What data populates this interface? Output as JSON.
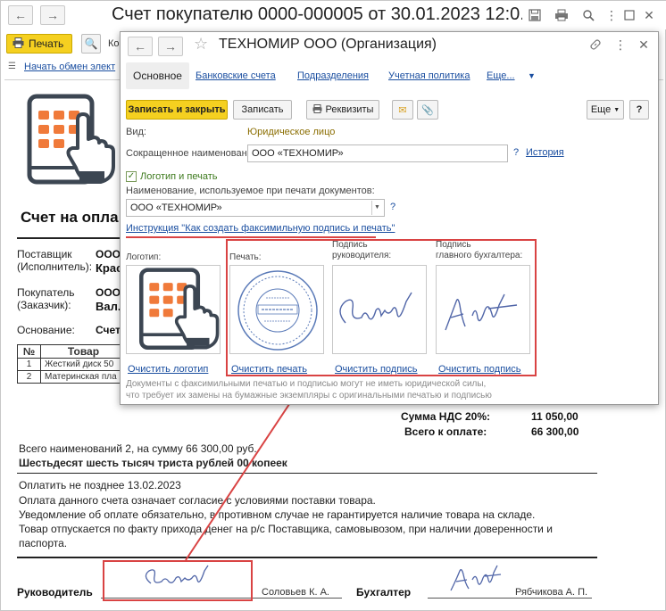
{
  "doc_window": {
    "title": "Счет покупателю 0000-000005 от 30.01.2023 12:0...",
    "print_label": "Печать",
    "toolbar_text": "Ко",
    "exchange_link": "Начать обмен элект",
    "heading": "Счет на опла",
    "supplier_label": "Поставщик\n(Исполнитель):",
    "supplier_val1": "ООО",
    "supplier_val2": "Крас",
    "buyer_label": "Покупатель\n(Заказчик):",
    "buyer_val1": "ООО",
    "buyer_val2": "Вал.",
    "basis_label": "Основание:",
    "basis_val": "Счет",
    "table_headers": [
      "№",
      "Товар"
    ],
    "table_rows": [
      [
        "1",
        "Жесткий диск 50"
      ],
      [
        "2",
        "Материнская пла"
      ]
    ],
    "vat_label": "Сумма НДС 20%:",
    "vat_value": "11 050,00",
    "total_label": "Всего к оплате:",
    "total_value": "66 300,00",
    "summary_line": "Всего наименований 2, на сумму 66 300,00 руб.",
    "summary_words": "Шестьдесят шесть тысяч триста рублей 00 копеек",
    "pay_by": "Оплатить не позднее 13.02.2023",
    "terms1": "Оплата данного счета означает согласие с условиями поставки товара.",
    "terms2": "Уведомление об оплате обязательно, в противном случае не гарантируется наличие товара на складе.",
    "terms3": "Товар отпускается по факту прихода денег на р/с Поставщика, самовывозом, при наличии доверенности и",
    "terms4": "паспорта.",
    "head_label": "Руководитель",
    "head_name": "Соловьев К. А.",
    "acc_label": "Бухгалтер",
    "acc_name": "Рябчикова А. П."
  },
  "org_window": {
    "title": "ТЕХНОМИР ООО (Организация)",
    "tabs": [
      "Основное",
      "Банковские счета",
      "Подразделения",
      "Учетная политика",
      "Еще..."
    ],
    "btn_save_close": "Записать и закрыть",
    "btn_save": "Записать",
    "btn_details": "Реквизиты",
    "btn_more": "Еще",
    "btn_help": "?",
    "kind_label": "Вид:",
    "kind_value": "Юридическое лицо",
    "short_name_label": "Сокращенное наименование:",
    "short_name_value": "ООО «ТЕХНОМИР»",
    "history_link": "История",
    "logo_print_label": "Логотип и печать",
    "print_name_label": "Наименование, используемое при печати документов:",
    "print_name_value": "ООО «ТЕХНОМИР»",
    "instruction_link": "Инструкция \"Как создать факсимильную подпись и печать\"",
    "logo_label": "Логотип:",
    "stamp_label": "Печать:",
    "head_sig_label": "Подпись\nруководителя:",
    "acc_sig_label": "Подпись\nглавного бухгалтера:",
    "clear_logo": "Очистить логотип",
    "clear_stamp": "Очистить печать",
    "clear_head_sig": "Очистить подпись",
    "clear_acc_sig": "Очистить подпись",
    "note": "Документы с факсимильными печатью и подписью могут не иметь юридической силы,\nчто требует их замены на бумажные экземпляры с оригинальными печатью и подписью",
    "question": "?"
  },
  "colors": {
    "accent_yellow": "#f5d020",
    "link_blue": "#1a4ea0",
    "highlight_red": "#d94343",
    "logo_orange": "#f07a3a",
    "logo_gray": "#3c4652"
  }
}
